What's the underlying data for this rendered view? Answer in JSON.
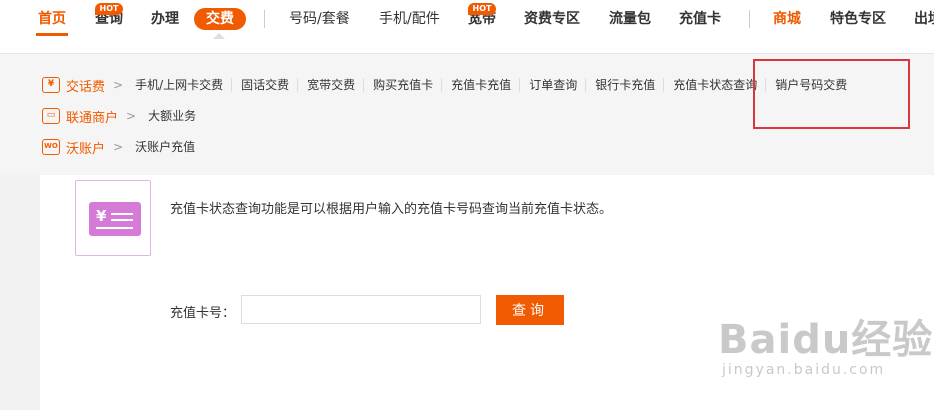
{
  "nav": {
    "items": [
      "首页",
      "查询",
      "办理",
      "交费",
      "号码/套餐",
      "手机/配件",
      "宽带",
      "资费专区",
      "流量包",
      "充值卡",
      "商城",
      "特色专区",
      "出境"
    ],
    "hot_label": "HOT"
  },
  "panel": {
    "rows": [
      {
        "icon": "¥",
        "title": "交话费",
        "links": [
          "手机/上网卡交费",
          "固话交费",
          "宽带交费",
          "购买充值卡",
          "充值卡充值",
          "订单查询",
          "银行卡充值",
          "充值卡状态查询",
          "销户号码交费"
        ]
      },
      {
        "icon": "▭",
        "title": "联通商户",
        "links": [
          "大额业务"
        ]
      },
      {
        "icon": "WO",
        "title": "沃账户",
        "links": [
          "沃账户充值"
        ]
      }
    ]
  },
  "main": {
    "description": "充值卡状态查询功能是可以根据用户输入的充值卡号码查询当前充值卡状态。",
    "card_icon_symbol": "¥",
    "label": "充值卡号：",
    "input_value": "",
    "button": "查询"
  },
  "watermark": {
    "main": "Baidu经验",
    "sub": "jingyan.baidu.com"
  },
  "colors": {
    "brand": "#f05a00",
    "highlight": "#d9363e",
    "card": "#d67ad8"
  }
}
